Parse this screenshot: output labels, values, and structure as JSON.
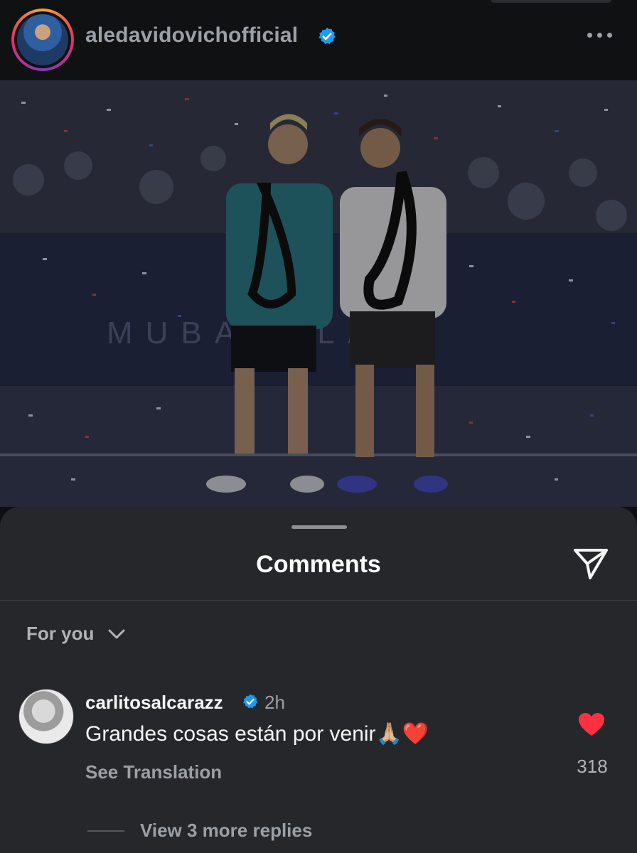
{
  "post": {
    "username": "aledavidovichofficial",
    "verified": true,
    "avatar_icon": "profile-avatar",
    "more_icon": "more-horizontal-icon",
    "photo_overlay_text": "MUBADALA"
  },
  "comments_sheet": {
    "title": "Comments",
    "share_icon": "paper-plane-icon",
    "filter_label": "For you",
    "filter_icon": "chevron-down-icon"
  },
  "comments": [
    {
      "username": "carlitosalcarazz",
      "verified": true,
      "time": "2h",
      "text": "Grandes cosas están por venir",
      "emojis": "🙏🏼❤️",
      "translate_label": "See Translation",
      "likes": "318",
      "liked": true,
      "replies_label": "View 3 more replies"
    }
  ],
  "colors": {
    "background": "#0e0f11",
    "sheet": "#26272b",
    "verified_blue": "#1d9bf0",
    "like_red": "#ff3040"
  }
}
